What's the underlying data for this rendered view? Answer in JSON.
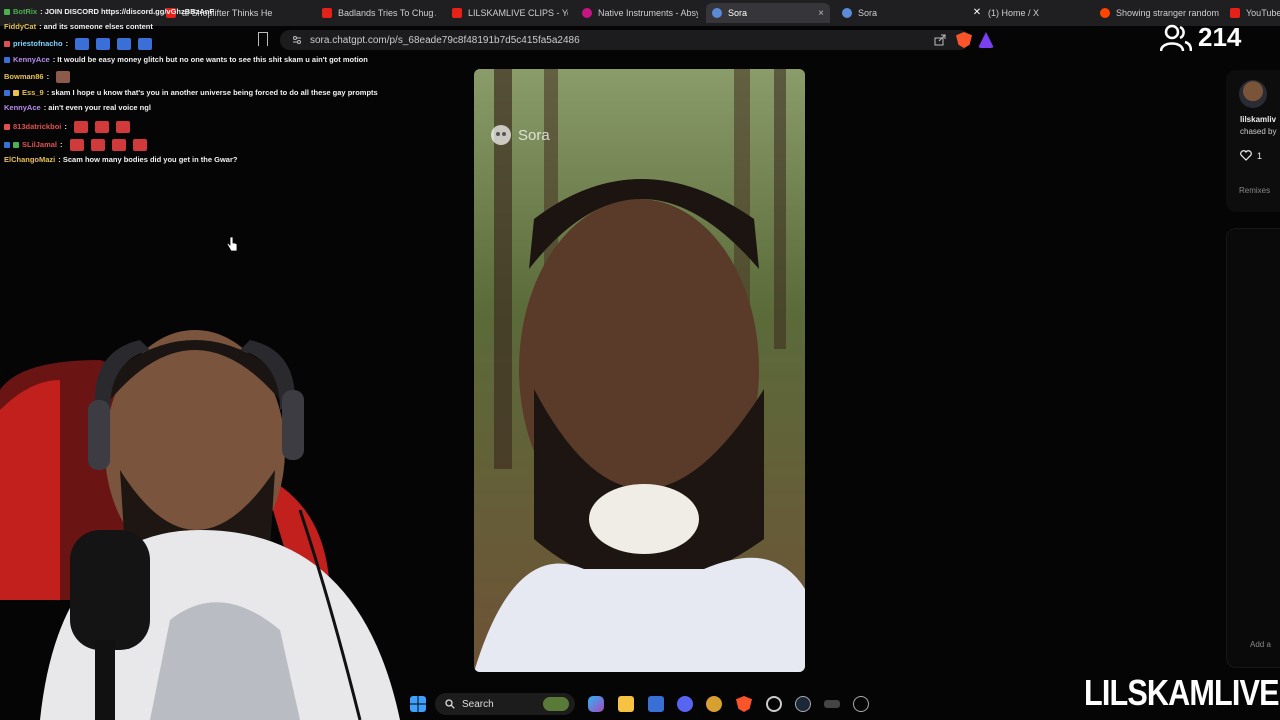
{
  "browser": {
    "tabs": [
      {
        "title": "al Shoplifter Thinks He",
        "favicon_color": "#e62117",
        "active": false
      },
      {
        "title": "Badlands Tries To Chug A Pi",
        "favicon_color": "#e62117",
        "active": false
      },
      {
        "title": "LILSKAMLIVE CLIPS - YouTu",
        "favicon_color": "#e62117",
        "active": false
      },
      {
        "title": "Native Instruments - Absyn",
        "favicon_color": "#c71585",
        "active": false
      },
      {
        "title": "Sora",
        "favicon_color": "#5b8bd6",
        "active": true
      },
      {
        "title": "Sora",
        "favicon_color": "#5b8bd6",
        "active": false
      },
      {
        "title": "(1) Home / X",
        "favicon_color": "#ffffff",
        "active": false
      },
      {
        "title": "Showing stranger random",
        "favicon_color": "#ff4500",
        "active": false
      },
      {
        "title": "YouTube",
        "favicon_color": "#e62117",
        "active": false
      }
    ],
    "active_tab_close": "×",
    "url": "sora.chatgpt.com/p/s_68eade79c8f48191b7d5c415fa5a2486",
    "icons": [
      "bookmark-icon",
      "site-info-icon",
      "share-icon",
      "brave-shield-icon",
      "brave-rewards-icon"
    ]
  },
  "stream": {
    "viewer_count": "214",
    "viewer_icon": "people-icon",
    "watermark": "LILSKAMLIVE"
  },
  "chat": [
    {
      "user": "BotRix",
      "user_color": "#4caf50",
      "text": ": JOIN DISCORD https://discord.gg/vGhzBBzAnF",
      "emotes": 0
    },
    {
      "user": "FiddyCat",
      "user_color": "#e5c14d",
      "text": ": and its someone elses content",
      "emotes": 0
    },
    {
      "user": "priestofnacho",
      "user_color": "#7ad3ff",
      "text": ":",
      "emotes": 4
    },
    {
      "user": "KennyAce",
      "user_color": "#b98cf0",
      "text": ": It would be easy money glitch but no one wants to see this shit skam u ain't got motion",
      "emotes": 0
    },
    {
      "user": "Bowman86",
      "user_color": "#e5c14d",
      "text": ":",
      "emotes": 1
    },
    {
      "user": "Ess_9",
      "user_color": "#e5c14d",
      "text": ": skam I hope u know that's you in another universe being forced to do all these gay prompts",
      "emotes": 0
    },
    {
      "user": "KennyAce",
      "user_color": "#b98cf0",
      "text": ": ain't even your real voice ngl",
      "emotes": 0
    },
    {
      "user": "813datrickboi",
      "user_color": "#e05050",
      "text": ":",
      "emotes": 3
    },
    {
      "user": "SLilJamal",
      "user_color": "#e05050",
      "text": ":",
      "emotes": 4
    },
    {
      "user": "ElChangoMazi",
      "user_color": "#e5c14d",
      "text": ": Scam how many bodies did you get in the Gwar?",
      "emotes": 0
    }
  ],
  "video": {
    "watermark": "Sora",
    "watermark_icon": "sora-logo-icon"
  },
  "post_panel": {
    "author": "lilskamliv",
    "subtitle": "chased by",
    "likes": "1",
    "like_icon": "heart-icon",
    "remixes_label": "Remixes",
    "comment_placeholder": "Add a"
  },
  "taskbar": {
    "search_label": "Search",
    "icons": [
      "windows-start-icon",
      "search-icon",
      "widget-icon",
      "copilot-icon",
      "file-explorer-icon",
      "store-icon",
      "discord-icon",
      "app-icon",
      "brave-icon",
      "chrome-icon",
      "steam-icon",
      "app-icon",
      "4k-app-icon"
    ]
  }
}
